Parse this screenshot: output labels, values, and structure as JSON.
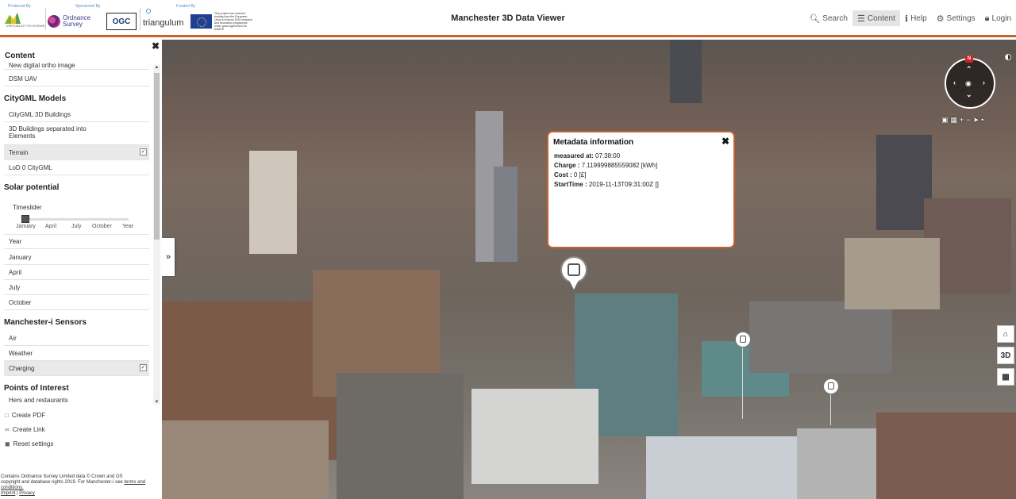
{
  "header": {
    "produced_by": "Produced By",
    "sponsored_by": "Sponsored By",
    "funded_by": "Funded By",
    "virtualcity_text": "VIRTUALCITYSYSTEMS",
    "os_text": "Ordnance Survey",
    "ogc_text": "OGC",
    "triangulum_text": "triangulum",
    "eu_text": "This project has received funding from the European Union's Horizon 2020 research and innovation programme under grant agreement No 646578",
    "title": "Manchester 3D Data Viewer",
    "nav": [
      {
        "label": "Search",
        "icon": "search-icon"
      },
      {
        "label": "Content",
        "icon": "menu-icon"
      },
      {
        "label": "Help",
        "icon": "info-icon"
      },
      {
        "label": "Settings",
        "icon": "gear-icon"
      },
      {
        "label": "Login",
        "icon": "lock-icon"
      }
    ]
  },
  "sidebar": {
    "content_title": "Content",
    "partial_item": "New digital ortho image",
    "items_top": [
      "DSM UAV"
    ],
    "citygml_title": "CityGML Models",
    "citygml_items": [
      "CityGML 3D Buildings",
      "3D Buildings separated into Elements",
      "Terrain",
      "LoD 0 CityGML"
    ],
    "solar_title": "Solar potential",
    "timeslider_label": "Timeslider",
    "slider_ticks": [
      "January",
      "April",
      "July",
      "October",
      "Year"
    ],
    "slider_value": 0,
    "solar_items": [
      "Year",
      "January",
      "April",
      "July",
      "October"
    ],
    "sensors_title": "Manchester-i Sensors",
    "sensor_items": [
      "Air",
      "Weather",
      "Charging"
    ],
    "poi_title": "Points of Interest",
    "poi_items": [
      "Hers and restaurants"
    ],
    "actions": [
      {
        "label": "Create PDF",
        "icon": "pdf-icon"
      },
      {
        "label": "Create Link",
        "icon": "link-icon"
      },
      {
        "label": "Reset settings",
        "icon": "reset-icon"
      }
    ],
    "footer": {
      "line1": "Contains Ordnance Survey Limited data © Crown and OS",
      "line2": "copyright and database rights 2019. For Manchester-i see",
      "terms": "terms and conditions.",
      "imprint": "Imprint",
      "sep": "|",
      "privacy": "Privacy"
    }
  },
  "popup": {
    "title": "Metadata information",
    "rows": [
      {
        "key": "measured at:",
        "value": "07:38:00"
      },
      {
        "key": "Charge :",
        "value": "7.119999885559082 [kWh]"
      },
      {
        "key": "Cost :",
        "value": "0 [£]"
      },
      {
        "key": "StartTime :",
        "value": "2019-11-13T09:31:00Z []"
      }
    ]
  },
  "map": {
    "compass_n": "N",
    "btn_3d": "3D",
    "expand": "»"
  },
  "colors": {
    "accent": "#c8642a"
  }
}
